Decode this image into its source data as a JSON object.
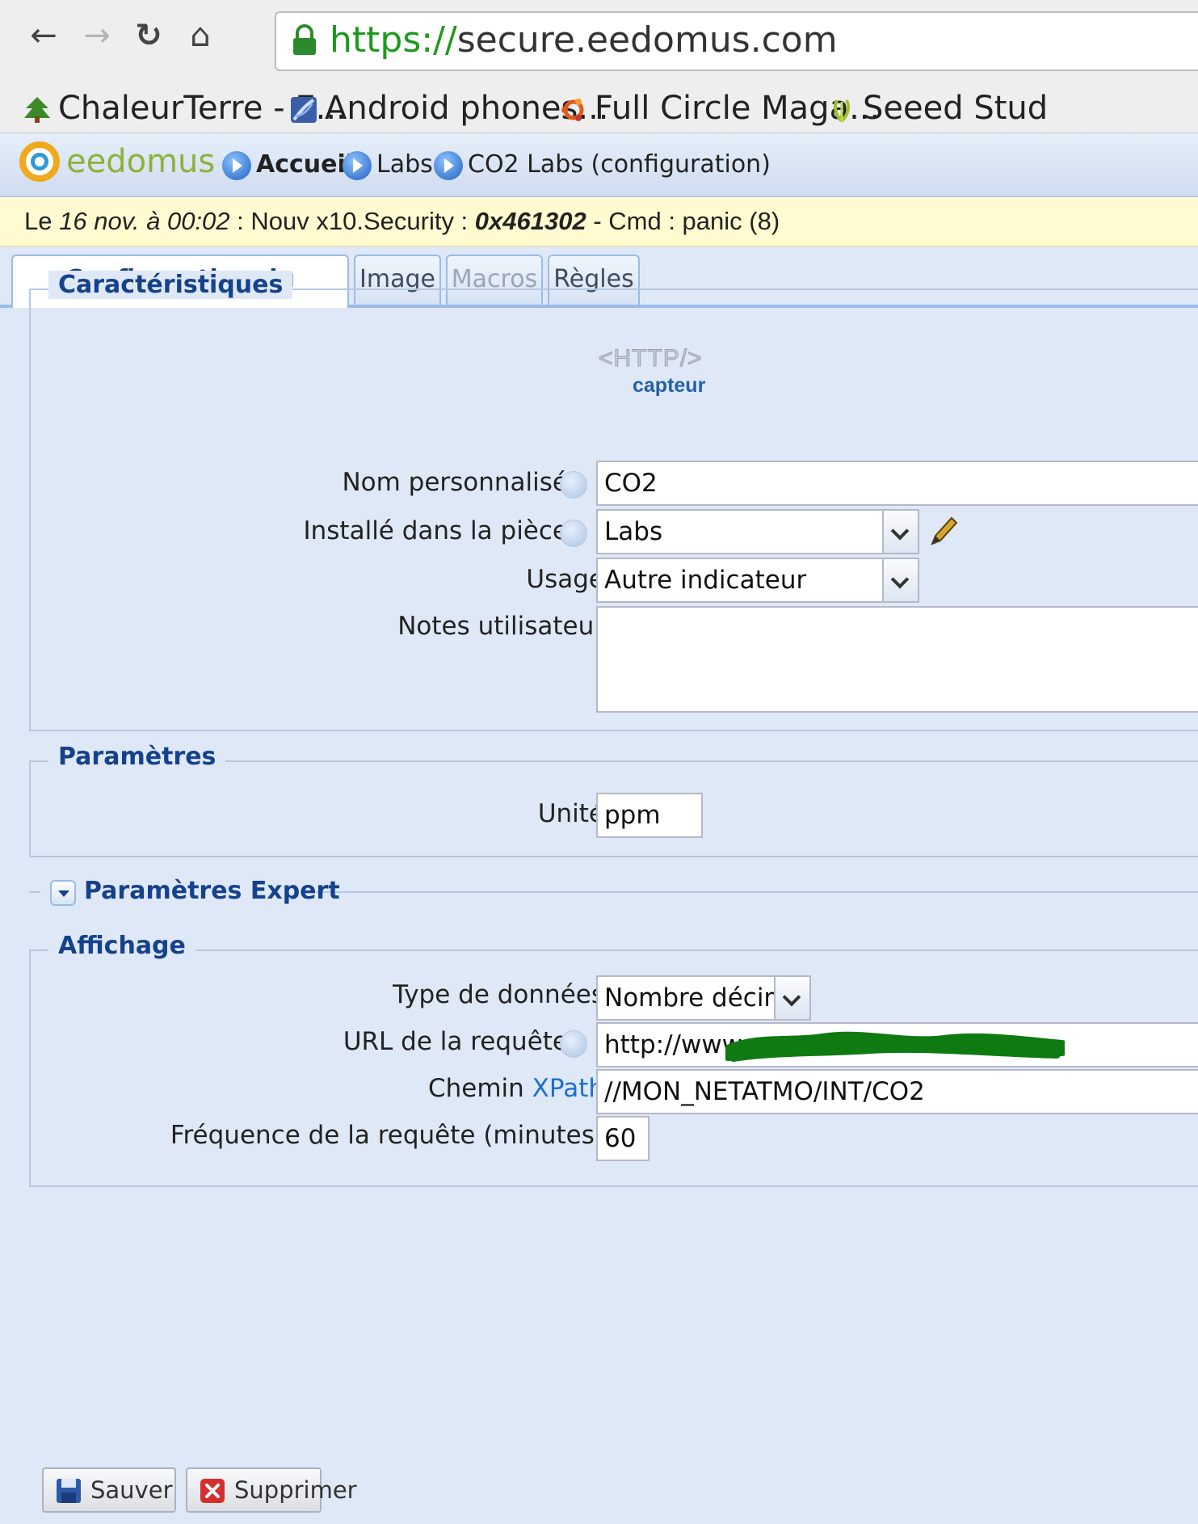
{
  "browser": {
    "url_scheme": "https://",
    "url_host": "secure.eedomus.com",
    "bookmarks": [
      {
        "label": "ChaleurTerre - E...",
        "icon": "tree-icon"
      },
      {
        "label": "Android phones...",
        "icon": "android-feather-icon"
      },
      {
        "label": "Full Circle Maga...",
        "icon": "ubuntu-icon"
      },
      {
        "label": "Seeed Stud",
        "icon": "seeed-icon"
      }
    ]
  },
  "app": {
    "logo_text": "eedomus",
    "breadcrumb": [
      "Accueil",
      "Labs",
      "CO2 Labs (configuration)"
    ]
  },
  "notification": {
    "prefix": "Le ",
    "date": "16 nov. à 00:02",
    "middle": " : Nouv x10.Security : ",
    "code": "0x461302",
    "suffix": " - Cmd : panic (8)"
  },
  "tabs": [
    {
      "label": "Configuration du périphérique",
      "state": "active"
    },
    {
      "label": "Image",
      "state": "normal"
    },
    {
      "label": "Macros",
      "state": "disabled"
    },
    {
      "label": "Règles",
      "state": "normal"
    }
  ],
  "characteristics": {
    "legend": "Caractéristiques",
    "device_type_logo": "<HTTP/>",
    "device_type_caption": "capteur",
    "name_label": "Nom personnalisé",
    "name_value": "CO2",
    "room_label": "Installé dans la pièce",
    "room_value": "Labs",
    "usage_label": "Usage",
    "usage_value": "Autre indicateur",
    "notes_label": "Notes utilisateur",
    "notes_value": ""
  },
  "parameters": {
    "legend": "Paramètres",
    "unit_label": "Unité",
    "unit_value": "ppm"
  },
  "expert": {
    "legend": "Paramètres Expert"
  },
  "display": {
    "legend": "Affichage",
    "datatype_label": "Type de données",
    "datatype_value": "Nombre décimal",
    "url_label": "URL de la requête",
    "url_value": "http://www.",
    "xpath_label_prefix": "Chemin ",
    "xpath_label_link": "XPath",
    "xpath_value": "//MON_NETATMO/INT/CO2",
    "freq_label": "Fréquence de la requête (minutes)",
    "freq_value": "60"
  },
  "actions": {
    "save_label": "Sauver",
    "delete_label": "Supprimer"
  },
  "colors": {
    "panel_bg": "#dfe8f6",
    "legend_text": "#15428b",
    "notification_bg": "#fffad0",
    "secure_scheme": "#1d9a1d",
    "redaction": "#0f7a12"
  }
}
